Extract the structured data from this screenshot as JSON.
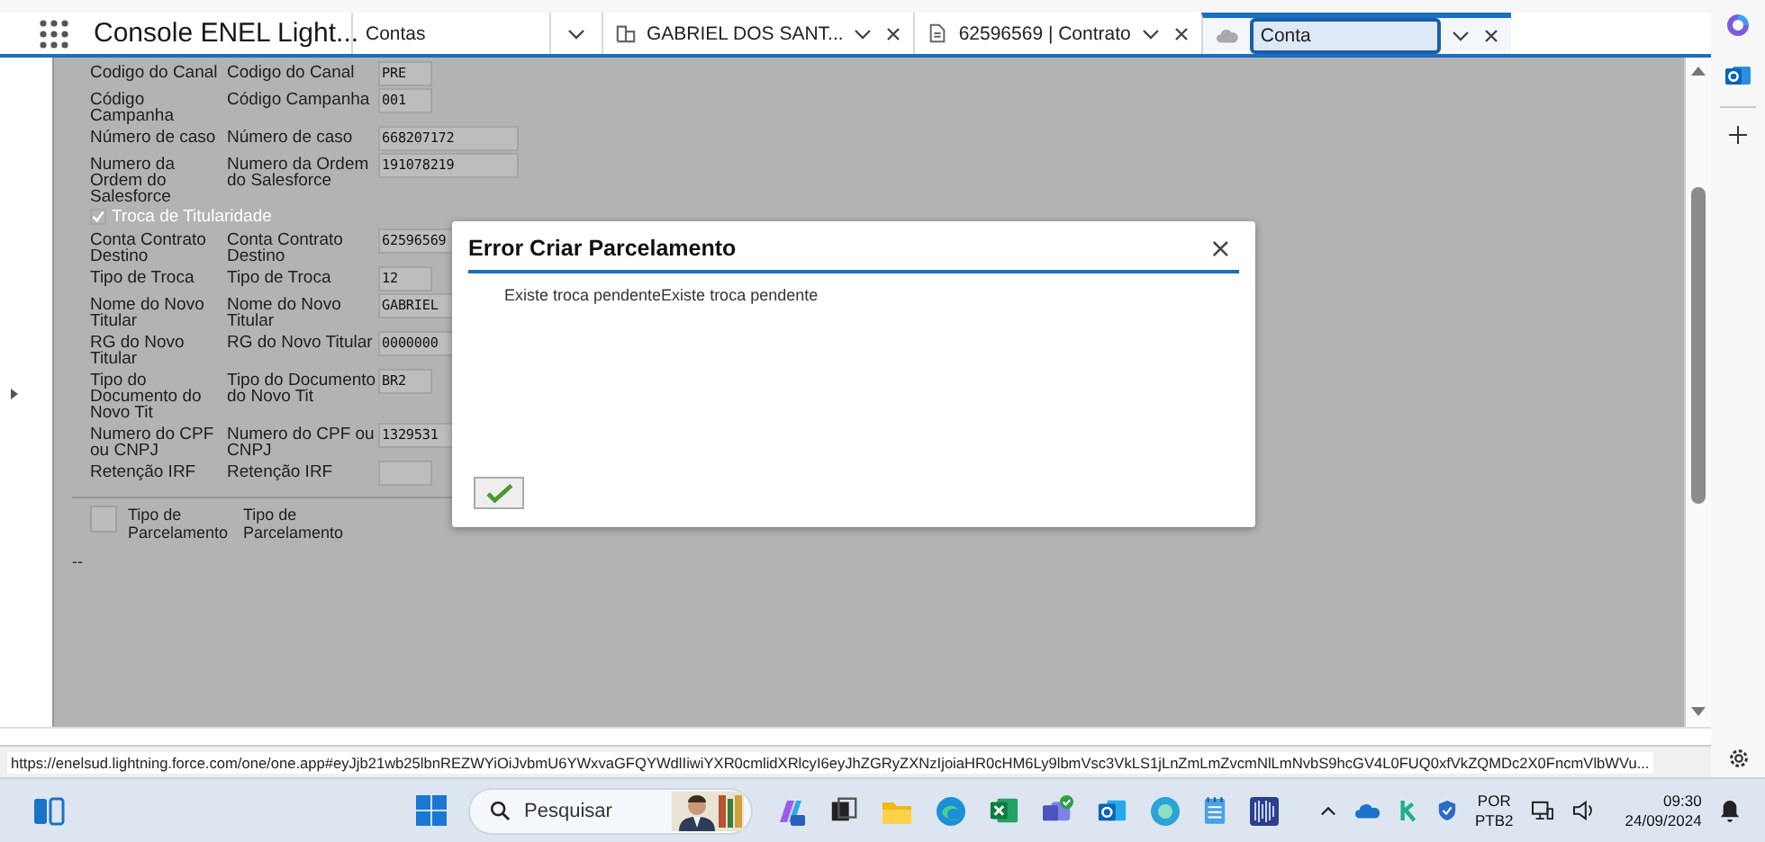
{
  "app": {
    "title": "Console ENEL Light..."
  },
  "tabs": [
    {
      "kind": "list",
      "label": "Contas",
      "selected": false,
      "closable": false
    },
    {
      "kind": "account",
      "label": "GABRIEL DOS SANT...",
      "selected": false,
      "closable": true
    },
    {
      "kind": "contract",
      "label": "62596569 | Contrato",
      "selected": false,
      "closable": true
    },
    {
      "kind": "record",
      "label": "Conta",
      "selected": true,
      "closable": true
    }
  ],
  "form": {
    "rows": [
      {
        "kind": "field",
        "labels": [
          "Codigo do Canal",
          "Codigo do Canal"
        ],
        "value": "PRE"
      },
      {
        "kind": "field",
        "labels": [
          "Código Campanha",
          "Código Campanha"
        ],
        "value": "001"
      },
      {
        "kind": "field",
        "labels": [
          "Número de caso",
          "Número de caso"
        ],
        "value": "668207172"
      },
      {
        "kind": "field",
        "labels": [
          "Numero da Ordem do Salesforce",
          "Numero da Ordem do Salesforce"
        ],
        "value": "191078219"
      },
      {
        "kind": "checkbox",
        "label": "Troca de Titularidade",
        "checked": true,
        "disabled": true
      },
      {
        "kind": "field",
        "labels": [
          "Conta Contrato Destino",
          "Conta Contrato Destino"
        ],
        "value": "62596569"
      },
      {
        "kind": "field",
        "labels": [
          "Tipo de Troca",
          "Tipo de Troca"
        ],
        "value": "12"
      },
      {
        "kind": "field",
        "labels": [
          "Nome do Novo Titular",
          "Nome do Novo Titular"
        ],
        "value": "GABRIEL"
      },
      {
        "kind": "field",
        "labels": [
          "RG do Novo Titular",
          "RG do Novo Titular"
        ],
        "value": "0000000"
      },
      {
        "kind": "field",
        "labels": [
          "Tipo do Documento do Novo Tit",
          "Tipo do Documento do Novo Tit"
        ],
        "value": "BR2"
      },
      {
        "kind": "field",
        "labels": [
          "Numero do CPF ou CNPJ",
          "Numero do CPF ou CNPJ"
        ],
        "value": "1329531"
      },
      {
        "kind": "field",
        "labels": [
          "Retenção IRF",
          "Retenção IRF"
        ]
      }
    ],
    "installment": {
      "labels": [
        "Tipo de Parcelamento",
        "Tipo de Parcelamento"
      ],
      "checked": false
    },
    "dash": "--"
  },
  "dialog": {
    "title": "Error Criar Parcelamento",
    "message": "Existe troca pendenteExiste troca pendente",
    "close": "×"
  },
  "status_url": "https://enelsud.lightning.force.com/one/one.app#eyJjb21wb25lbnREZWYiOiJvbmU6YWxvaGFQYWdlIiwiYXR0cmlidXRlcyI6eyJhZGRyZXNzIjoiaHR0cHM6Ly9lbmVsc3VkLS1jLnZmLmZvcmNlLmNvbS9hcGV4L0FUQ0xfVkZQMDc2X0FncmVlbWVu...",
  "taskbar": {
    "search_placeholder": "Pesquisar",
    "language": "POR",
    "layout": "PTB2",
    "time": "09:30",
    "date": "24/09/2024"
  }
}
